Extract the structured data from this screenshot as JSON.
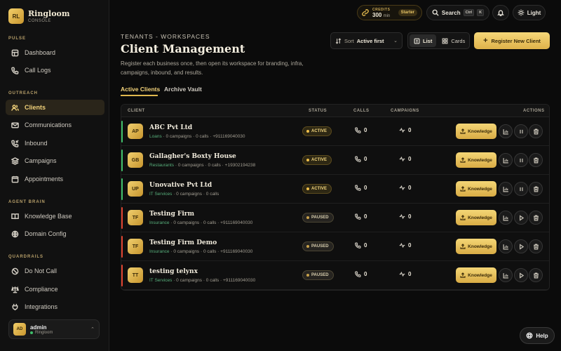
{
  "brand": {
    "logo": "RL",
    "name": "Ringloom",
    "sub": "CONSOLE"
  },
  "sidebar": {
    "sections": [
      {
        "label": "PULSE",
        "items": [
          {
            "label": "Dashboard",
            "icon": "home-icon"
          },
          {
            "label": "Call Logs",
            "icon": "phone-icon"
          }
        ]
      },
      {
        "label": "OUTREACH",
        "items": [
          {
            "label": "Clients",
            "icon": "users-icon",
            "active": true
          },
          {
            "label": "Communications",
            "icon": "mail-icon"
          },
          {
            "label": "Inbound",
            "icon": "phone-incoming-icon"
          },
          {
            "label": "Campaigns",
            "icon": "layers-icon"
          },
          {
            "label": "Appointments",
            "icon": "calendar-icon"
          }
        ]
      },
      {
        "label": "AGENT BRAIN",
        "items": [
          {
            "label": "Knowledge Base",
            "icon": "book-icon"
          },
          {
            "label": "Domain Config",
            "icon": "globe-icon"
          }
        ]
      },
      {
        "label": "QUARDRAILS",
        "items": [
          {
            "label": "Do Not Call",
            "icon": "ban-icon"
          },
          {
            "label": "Compliance",
            "icon": "scale-icon"
          },
          {
            "label": "Integrations",
            "icon": "plug-icon"
          }
        ]
      }
    ],
    "user": {
      "initials": "AD",
      "name": "admin",
      "org": "Ringloom"
    }
  },
  "topbar": {
    "credits_label": "CREDITS",
    "credits_value": "300",
    "credits_unit": "min",
    "plan": "Starter",
    "search_label": "Search",
    "search_kbd_1": "Ctrl",
    "search_kbd_2": "K",
    "theme_label": "Light"
  },
  "header": {
    "eyebrow": "TENANTS - WORKSPACES",
    "title": "Client Management",
    "description": "Register each business once, then open its workspace for branding, infra, campaigns, inbound, and results."
  },
  "controls": {
    "sort_label": "Sort",
    "sort_value": "Active first",
    "view_list": "List",
    "view_cards": "Cards",
    "register_label": "Register New Client"
  },
  "tabs": {
    "active": "Active Clients",
    "archive": "Archive Vault"
  },
  "table": {
    "headers": {
      "client": "CLIENT",
      "status": "STATUS",
      "calls": "CALLS",
      "campaigns": "CAMPAIGNS",
      "actions": "ACTIONS"
    },
    "knowledge_label": "Knowledge",
    "rows": [
      {
        "initials": "AP",
        "name": "ABC Pvt Ltd",
        "industry": "Loans",
        "detail": " · 0 campaigns · 0 calls · +911169040030",
        "status": "ACTIVE",
        "calls": "0",
        "campaigns": "0",
        "accent": "#3fbf6a"
      },
      {
        "initials": "GB",
        "name": "Gallagher's Boxty House",
        "industry": "Restaurants",
        "detail": " · 0 campaigns · 0 calls · +19302194238",
        "status": "ACTIVE",
        "calls": "0",
        "campaigns": "0",
        "accent": "#3fbf6a"
      },
      {
        "initials": "UP",
        "name": "Unovative Pvt Ltd",
        "industry": "IT Services",
        "detail": " · 0 campaigns · 0 calls",
        "status": "ACTIVE",
        "calls": "0",
        "campaigns": "0",
        "accent": "#3fbf6a"
      },
      {
        "initials": "TF",
        "name": "Testing Firm",
        "industry": "Insurance",
        "detail": " · 0 campaigns · 0 calls · +911169040030",
        "status": "PAUSED",
        "calls": "0",
        "campaigns": "0",
        "accent": "#e0432f"
      },
      {
        "initials": "TF",
        "name": "Testing Firm Demo",
        "industry": "Insurance",
        "detail": " · 0 campaigns · 0 calls · +911169040030",
        "status": "PAUSED",
        "calls": "0",
        "campaigns": "0",
        "accent": "#e0432f"
      },
      {
        "initials": "TT",
        "name": "testing telynx",
        "industry": "IT Services",
        "detail": " · 0 campaigns · 0 calls · +911169040030",
        "status": "PAUSED",
        "calls": "0",
        "campaigns": "0",
        "accent": "#e0432f"
      }
    ]
  },
  "help_label": "Help",
  "colors": {
    "accent_gold": "#e0b84e",
    "active_green": "#3fbf6a",
    "paused_red": "#e0432f",
    "background": "#0b0b0b"
  }
}
